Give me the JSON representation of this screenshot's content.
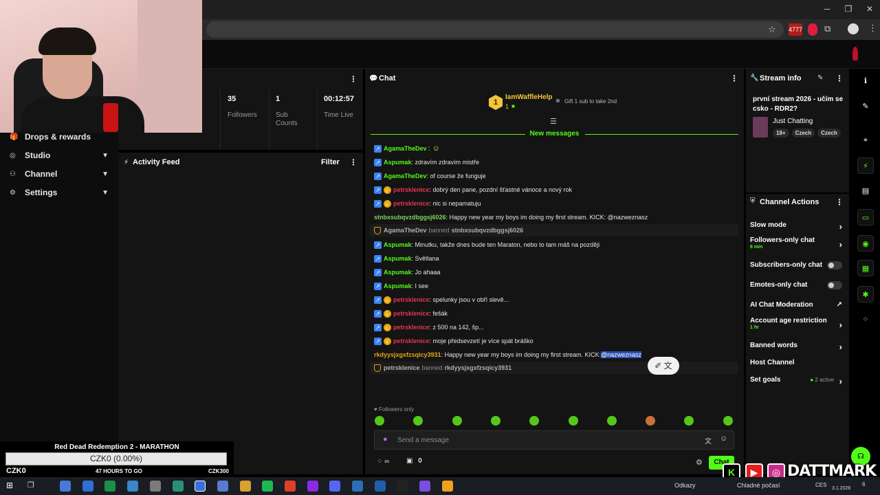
{
  "sidebar": {
    "items": [
      {
        "label": "Drops & rewards",
        "icon": "gift-icon",
        "expandable": false
      },
      {
        "label": "Studio",
        "icon": "studio-icon",
        "expandable": true
      },
      {
        "label": "Channel",
        "icon": "channel-icon",
        "expandable": true
      },
      {
        "label": "Settings",
        "icon": "gear-icon",
        "expandable": true
      }
    ]
  },
  "stats": {
    "items": [
      {
        "value": "35",
        "label": "Followers"
      },
      {
        "value": "1",
        "label": "Sub Counts"
      },
      {
        "value": "00:12:57",
        "label": "Time Live"
      }
    ],
    "partial_label": "s"
  },
  "activity": {
    "title": "Activity Feed",
    "filter_label": "Filter"
  },
  "goal": {
    "title": "Red Dead Redemption 2 - MARATHON",
    "bar_text": "CZK0 (0.00%)",
    "progress": 0,
    "left": "CZK0",
    "middle": "47 HOURS TO GO",
    "right": "CZK300"
  },
  "chat": {
    "title": "Chat",
    "pinned": {
      "badge": "1",
      "user": "IamWaffleHelp",
      "count": "1",
      "gift_text": "Gift 1 sub to take 2nd"
    },
    "new_messages_label": "New messages",
    "messages": [
      {
        "type": "msg",
        "badges": [
          "blue"
        ],
        "user": "AgamaTheDev",
        "color": "#53fc18",
        "text": ""
      },
      {
        "type": "msg",
        "badges": [
          "blue"
        ],
        "user": "Aspumak",
        "color": "#53fc18",
        "text": ": zdravím zdravím mistře"
      },
      {
        "type": "msg",
        "badges": [
          "blue"
        ],
        "user": "AgamaTheDev",
        "color": "#53fc18",
        "text": ": of course že funguje"
      },
      {
        "type": "msg",
        "badges": [
          "blue",
          "gold"
        ],
        "user": "petrsklenice",
        "color": "#e8344f",
        "text": ": dobrý den pane, pozdní šťastné vánoce a nový rok"
      },
      {
        "type": "msg",
        "badges": [
          "blue",
          "gold"
        ],
        "user": "petrsklenice",
        "color": "#e8344f",
        "text": ": nic si nepamatuju"
      },
      {
        "type": "msg",
        "badges": [],
        "user": "stnbxsubqvzdbggsj6026",
        "color": "#7bd65a",
        "text": ": Happy new year my boys im doing my first stream. KICK: @nazweznasz"
      },
      {
        "type": "sys",
        "actor": "AgamaTheDev",
        "action": "banned",
        "target": "stnbxsubqvzdbggsj6026"
      },
      {
        "type": "msg",
        "badges": [
          "blue"
        ],
        "user": "Aspumak",
        "color": "#53fc18",
        "text": ": Minutku, takže dnes bude ten Maraton, nebo to tam máš na později"
      },
      {
        "type": "msg",
        "badges": [
          "blue"
        ],
        "user": "Aspumak",
        "color": "#53fc18",
        "text": ": Světlana"
      },
      {
        "type": "msg",
        "badges": [
          "blue"
        ],
        "user": "Aspumak",
        "color": "#53fc18",
        "text": ": Jo ahaaa"
      },
      {
        "type": "msg",
        "badges": [
          "blue"
        ],
        "user": "Aspumak",
        "color": "#53fc18",
        "text": ": I see"
      },
      {
        "type": "msg",
        "badges": [
          "blue",
          "gold"
        ],
        "user": "petrsklenice",
        "color": "#e8344f",
        "text": ": spelunky jsou v obří slevě..."
      },
      {
        "type": "msg",
        "badges": [
          "blue",
          "gold"
        ],
        "user": "petrsklenice",
        "color": "#e8344f",
        "text": ": fešák"
      },
      {
        "type": "msg",
        "badges": [
          "blue",
          "gold"
        ],
        "user": "petrsklenice",
        "color": "#e8344f",
        "text": ": z 500 na 142, šp..."
      },
      {
        "type": "msg",
        "badges": [
          "blue",
          "gold"
        ],
        "user": "petrsklenice",
        "color": "#e8344f",
        "text": ": moje předsevzetí je více spát bráško"
      },
      {
        "type": "msg",
        "badges": [],
        "user": "rkdyysjxgxfzsqicy3931",
        "color": "#e2a617",
        "text": ": Happy new year my boys im doing my first stream. KICK: ",
        "highlight": "@nazweznasz"
      },
      {
        "type": "sys",
        "actor": "petrsklenice",
        "action": "banned",
        "target": "rkdyysjxgxfzsqicy3931"
      }
    ],
    "followers_only": "Followers only",
    "placeholder": "Send a message",
    "infinity_count": "0",
    "gift_count": "0",
    "send_label": "Chat"
  },
  "stream_info": {
    "title": "Stream info",
    "stream_title": "první stream 2026 - učím se csko - RDR2?",
    "category": "Just Chatting",
    "tags": [
      "18+",
      "Czech",
      "Czech"
    ]
  },
  "channel_actions": {
    "title": "Channel Actions",
    "items": [
      {
        "label": "Slow mode",
        "kind": "arrow"
      },
      {
        "label": "Followers-only chat",
        "sub": "6 min",
        "kind": "arrow"
      },
      {
        "label": "Subscribers-only chat",
        "kind": "toggle"
      },
      {
        "label": "Emotes-only chat",
        "kind": "toggle"
      },
      {
        "label": "AI Chat Moderation",
        "kind": "external"
      },
      {
        "label": "Account age restriction",
        "sub": "1 hr",
        "kind": "arrow"
      },
      {
        "label": "Banned words",
        "kind": "arrow"
      },
      {
        "label": "Host Channel",
        "kind": "none"
      },
      {
        "label": "Set goals",
        "extra": "2 active",
        "kind": "arrow"
      }
    ]
  },
  "browser": {
    "badge": "4777"
  },
  "taskbar": {
    "weather": "Chladné počasí",
    "links": "Odkazy",
    "lang": "CES",
    "date": "3.1.2026",
    "notif": "6"
  },
  "overlay": {
    "brand": "DATTMARK"
  }
}
